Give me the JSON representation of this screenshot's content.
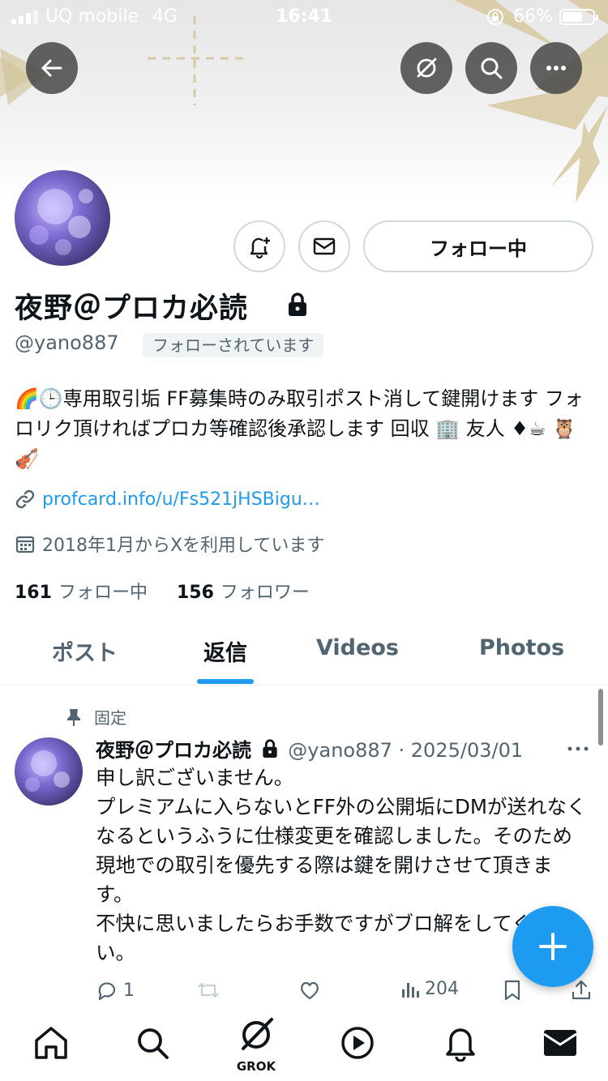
{
  "status_bar": {
    "carrier": "UQ mobile",
    "network": "4G",
    "time": "16:41",
    "battery": "66%"
  },
  "profile": {
    "name": "夜野＠プロカ必読",
    "handle": "@yano887",
    "follows_you": "フォローされています",
    "bio": "🌈🕒専用取引垢 FF募集時のみ取引ポスト消して鍵開けます フォロリク頂ければプロカ等確認後承認します 回収 🏢 友人 ♦☕ 🦉🎻",
    "link": "profcard.info/u/Fs521jHSBigu…",
    "joined": "2018年1月からXを利用しています",
    "following_count": "161",
    "following_label": "フォロー中",
    "followers_count": "156",
    "followers_label": "フォロワー",
    "follow_button": "フォロー中"
  },
  "tabs": [
    {
      "label": "ポスト",
      "active": false
    },
    {
      "label": "返信",
      "active": true
    },
    {
      "label": "Videos",
      "active": false
    },
    {
      "label": "Photos",
      "active": false
    }
  ],
  "pinned_tweet": {
    "pinned_label": "固定",
    "author_name": "夜野＠プロカ必読",
    "meta": "@yano887 · 2025/03/01",
    "text": "申し訳ございません。\nプレミアムに入らないとFF外の公開垢にDMが送れなくなるというふうに仕様変更を確認しました。そのため現地での取引を優先する際は鍵を開けさせて頂きます。\n不快に思いましたらお手数ですがブロ解をしてください。",
    "replies": "1",
    "views": "204"
  },
  "bottom_nav": {
    "grok_label": "GROK"
  },
  "colors": {
    "accent": "#1d9bf0",
    "text": "#0f1419",
    "muted": "#536471"
  },
  "icons": [
    "back-arrow-icon",
    "grok-icon",
    "search-icon",
    "more-icon",
    "bell-plus-icon",
    "mail-icon",
    "lock-icon",
    "link-icon",
    "calendar-icon",
    "pin-icon",
    "reply-icon",
    "retweet-icon",
    "like-icon",
    "views-icon",
    "bookmark-icon",
    "share-icon",
    "plus-icon",
    "home-icon",
    "play-icon",
    "bell-icon"
  ]
}
